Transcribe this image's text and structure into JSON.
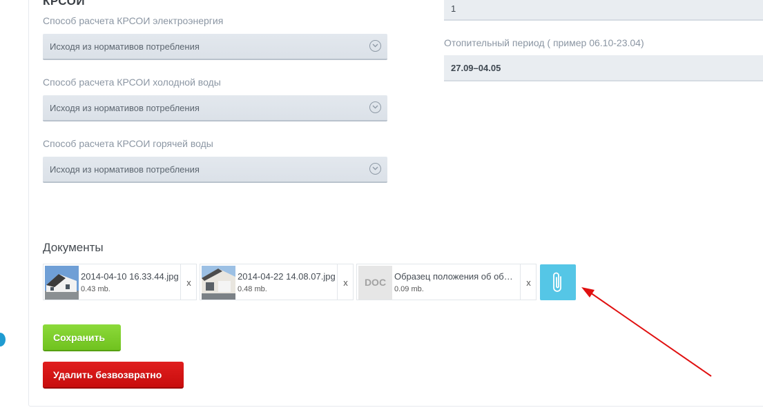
{
  "section": {
    "title": "КРСОИ"
  },
  "fields": [
    {
      "label": "Способ расчета КРСОИ электроэнергия",
      "value": "Исходя из нормативов потребления"
    },
    {
      "label": "Способ расчета КРСОИ холодной воды",
      "value": "Исходя из нормативов потребления"
    },
    {
      "label": "Способ расчета КРСОИ горячей воды",
      "value": "Исходя из нормативов потребления"
    }
  ],
  "right": {
    "top_input_value": "1",
    "heating_label": "Отопительный период ( пример 06.10-23.04)",
    "heating_value": "27.09–04.05"
  },
  "documents": {
    "title": "Документы",
    "files": [
      {
        "name": "2014-04-10 16.33.44.jpg",
        "size": "0.43 mb.",
        "remove": "x"
      },
      {
        "name": "2014-04-22 14.08.07.jpg",
        "size": "0.48 mb.",
        "remove": "x"
      },
      {
        "name": "Образец положения об об…",
        "size": "0.09 mb.",
        "remove": "x",
        "type_badge": "DOC"
      }
    ]
  },
  "actions": {
    "save_label": "Сохранить",
    "delete_label": "Удалить безвозвратно"
  },
  "colors": {
    "save": "#78c928",
    "delete": "#d41414",
    "attach": "#55c6e6",
    "annotation_arrow": "#e01010"
  }
}
